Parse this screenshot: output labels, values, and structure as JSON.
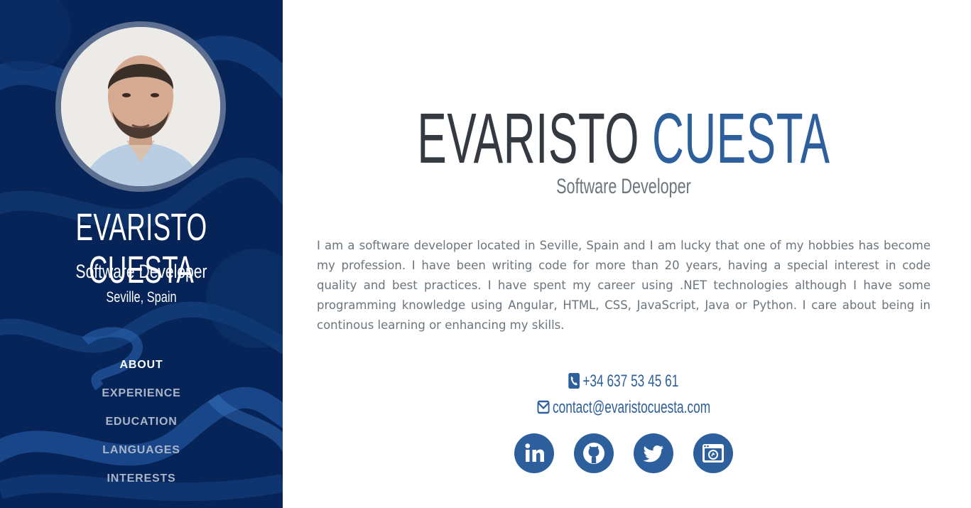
{
  "sidebar": {
    "name": "EVARISTO CUESTA",
    "role": "Software Developer",
    "location": "Seville, Spain",
    "nav": [
      {
        "label": "ABOUT",
        "active": true
      },
      {
        "label": "EXPERIENCE",
        "active": false
      },
      {
        "label": "EDUCATION",
        "active": false
      },
      {
        "label": "LANGUAGES",
        "active": false
      },
      {
        "label": "INTERESTS",
        "active": false
      }
    ]
  },
  "main": {
    "first_name": "EVARISTO",
    "last_name": "CUESTA",
    "subtitle": "Software Developer",
    "bio": "I am a software developer located in Seville, Spain and I am lucky that one of my hobbies has become my profession. I have been writing code for more than 20 years, having a special interest in code quality and best practices. I have spent my career using .NET technologies although I have some programming knowledge using Angular, HTML, CSS, JavaScript, Java or Python. I care about being in continous learning or enhancing my skills.",
    "phone": "+34 637 53 45 61",
    "email": "contact@evaristocuesta.com",
    "socials": [
      {
        "icon": "linkedin-icon"
      },
      {
        "icon": "github-icon"
      },
      {
        "icon": "twitter-icon"
      },
      {
        "icon": "blog-icon"
      }
    ]
  },
  "colors": {
    "sidebar_bg": "#062457",
    "accent": "#2d5f9c",
    "title_dark": "#343a40",
    "muted_text": "#6c757d",
    "nav_inactive": "#a9b5c8"
  }
}
